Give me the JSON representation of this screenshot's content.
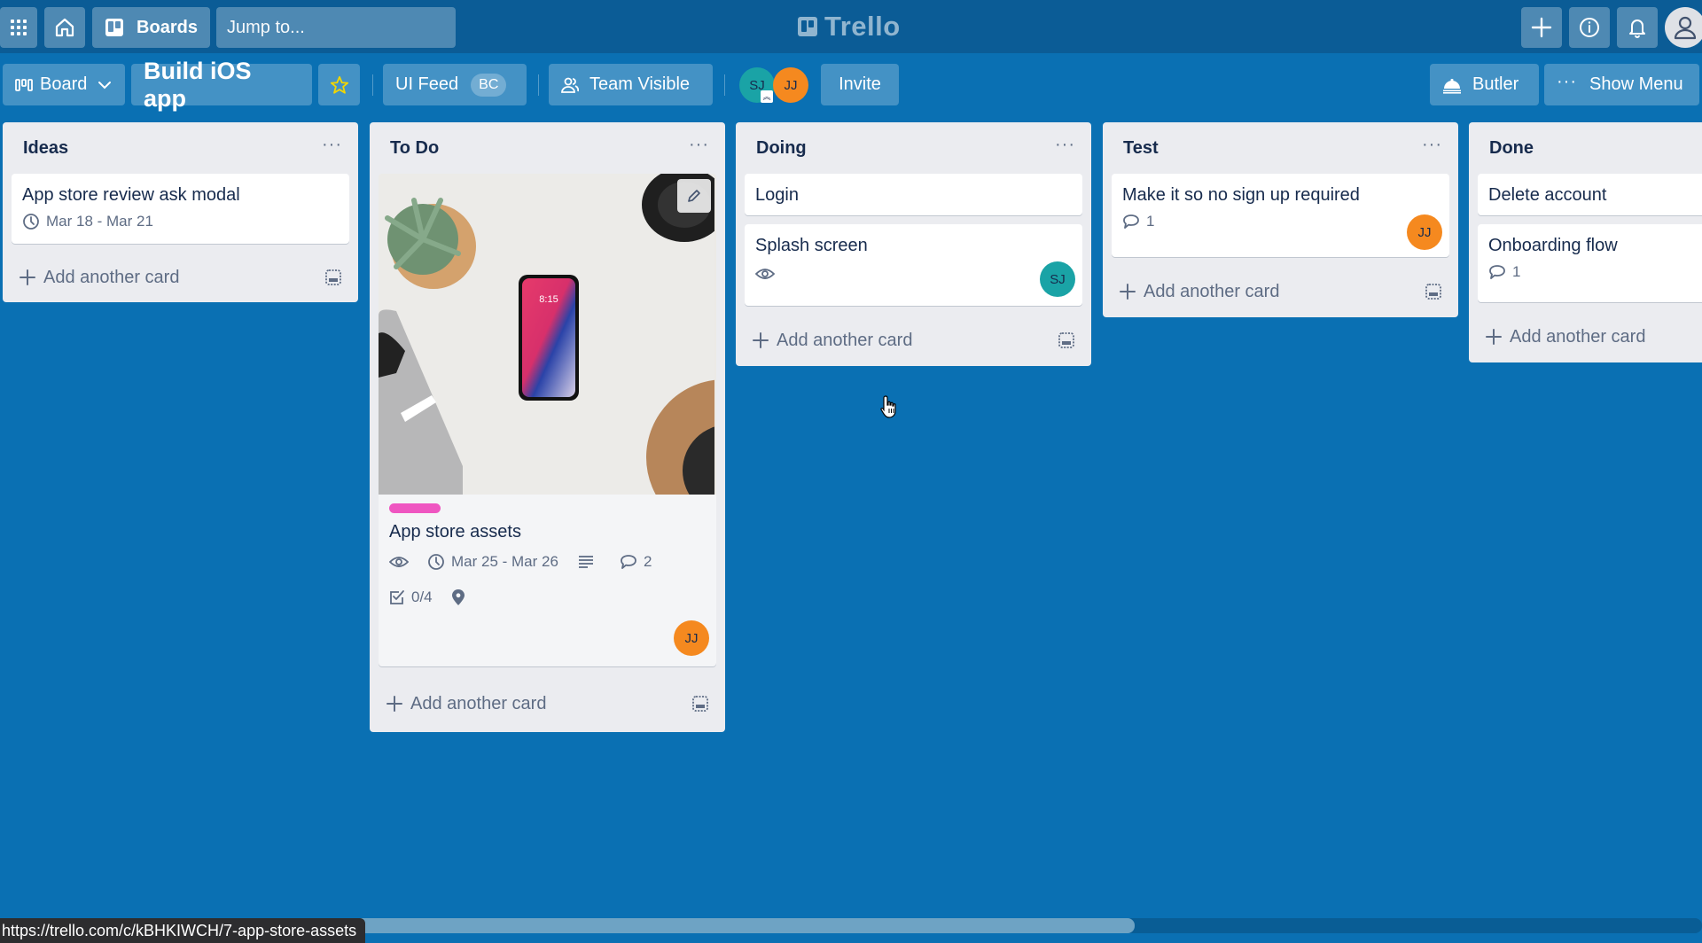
{
  "topnav": {
    "apps_icon": "grid-icon",
    "home_icon": "home-icon",
    "boards_label": "Boards",
    "search_placeholder": "Jump to...",
    "logo_text": "Trello",
    "create_icon": "plus-icon",
    "info_icon": "info-icon",
    "notifications_icon": "bell-icon",
    "profile_icon": "user-icon"
  },
  "board_header": {
    "view_switcher": "Board",
    "board_title": "Build iOS app",
    "starred": true,
    "team_name": "UI Feed",
    "team_badge": "BC",
    "visibility": "Team Visible",
    "members": [
      {
        "initials": "SJ",
        "color": "#1aa3a6",
        "admin": true
      },
      {
        "initials": "JJ",
        "color": "#f5891f",
        "admin": false
      }
    ],
    "invite_label": "Invite",
    "butler_label": "Butler",
    "menu_label": "Show Menu"
  },
  "lists": [
    {
      "title": "Ideas",
      "add_label": "Add another card",
      "cards": [
        {
          "title": "App store review ask modal",
          "due": "Mar 18 - Mar 21"
        }
      ]
    },
    {
      "title": "To Do",
      "add_label": "Add another card",
      "cards": [
        {
          "title": "App store assets",
          "has_cover": true,
          "label_color": "#ef56c1",
          "watching": true,
          "due": "Mar 25 - Mar 26",
          "has_description": true,
          "comments": "2",
          "checklist": "0/4",
          "has_location": true,
          "member": {
            "initials": "JJ",
            "color": "#f5891f"
          }
        }
      ]
    },
    {
      "title": "Doing",
      "add_label": "Add another card",
      "cards": [
        {
          "title": "Login"
        },
        {
          "title": "Splash screen",
          "watching": true,
          "member": {
            "initials": "SJ",
            "color": "#1aa3a6"
          }
        }
      ]
    },
    {
      "title": "Test",
      "add_label": "Add another card",
      "cards": [
        {
          "title": "Make it so no sign up required",
          "comments": "1",
          "member": {
            "initials": "JJ",
            "color": "#f5891f"
          }
        }
      ]
    },
    {
      "title": "Done",
      "add_label": "Add another card",
      "cards": [
        {
          "title": "Delete account"
        },
        {
          "title": "Onboarding flow",
          "comments": "1"
        }
      ]
    }
  ],
  "status_url": "https://trello.com/c/kBHKIWCH/7-app-store-assets",
  "colors": {
    "board_bg": "#0a70b3",
    "topnav_bg": "#0b5c96",
    "list_bg": "#ebecf0",
    "star": "#f2d600"
  }
}
